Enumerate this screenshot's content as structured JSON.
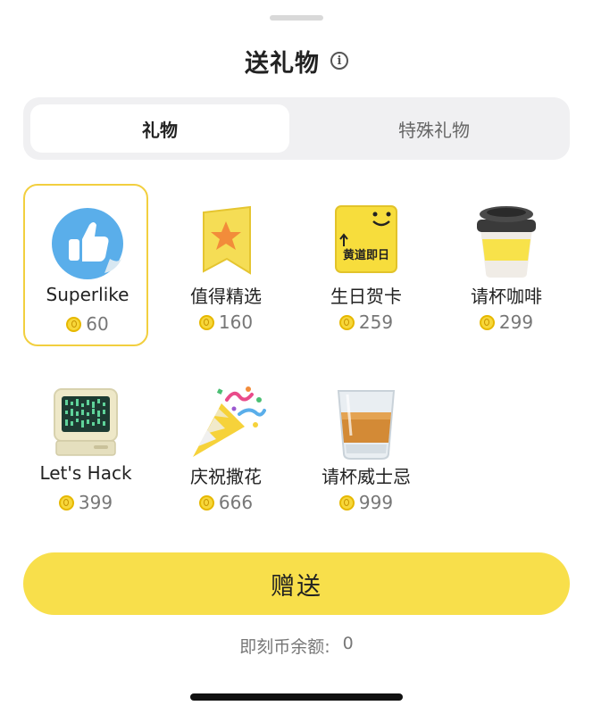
{
  "sheet": {
    "title": "送礼物",
    "info_icon": "info-icon"
  },
  "tabs": [
    {
      "label": "礼物",
      "active": true
    },
    {
      "label": "特殊礼物",
      "active": false
    }
  ],
  "gifts": [
    {
      "name": "Superlike",
      "price": "60",
      "icon": "thumbs-up-icon",
      "selected": true
    },
    {
      "name": "值得精选",
      "price": "160",
      "icon": "bookmark-star-icon",
      "selected": false
    },
    {
      "name": "生日贺卡",
      "price": "259",
      "icon": "birthday-card-icon",
      "card_text": "黄道即日",
      "selected": false
    },
    {
      "name": "请杯咖啡",
      "price": "299",
      "icon": "coffee-cup-icon",
      "selected": false
    },
    {
      "name": "Let's Hack",
      "price": "399",
      "icon": "computer-icon",
      "selected": false
    },
    {
      "name": "庆祝撒花",
      "price": "666",
      "icon": "party-popper-icon",
      "selected": false
    },
    {
      "name": "请杯威士忌",
      "price": "999",
      "icon": "whiskey-glass-icon",
      "selected": false
    }
  ],
  "send_button": {
    "label": "赠送",
    "color": "#f8df4b"
  },
  "balance": {
    "label": "即刻币余额:",
    "value": "0"
  },
  "colors": {
    "accent": "#f8df4b",
    "selected_border": "#f2cf3f",
    "coin": "#f7d73a"
  }
}
